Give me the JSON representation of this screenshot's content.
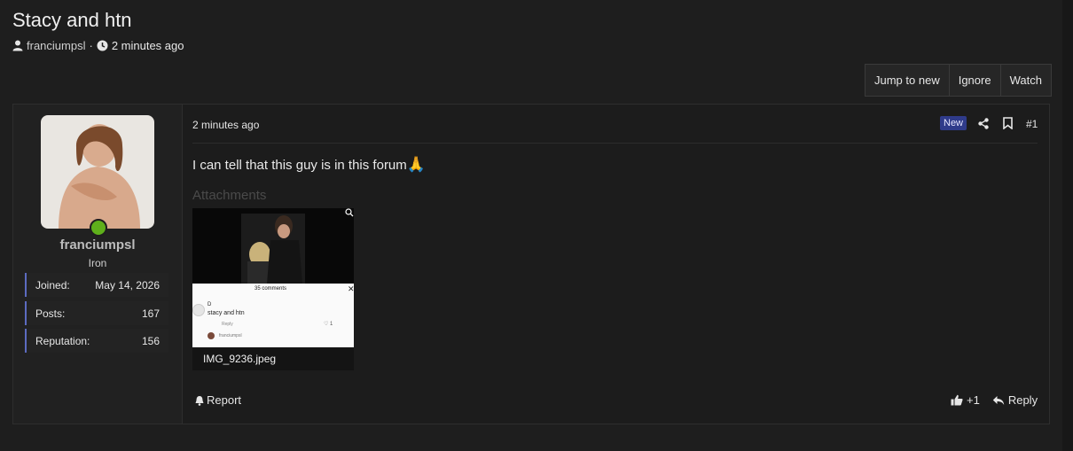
{
  "thread": {
    "title": "Stacy and htn",
    "author": "franciumpsl",
    "time_ago": "2 minutes ago"
  },
  "actions": {
    "jump_new": "Jump to new",
    "ignore": "Ignore",
    "watch": "Watch"
  },
  "user": {
    "name": "franciumpsl",
    "title": "Iron",
    "stats": [
      {
        "label": "Joined:",
        "value": "May 14, 2026"
      },
      {
        "label": "Posts:",
        "value": "167"
      },
      {
        "label": "Reputation:",
        "value": "156"
      }
    ],
    "online_color": "#5fb01b"
  },
  "post": {
    "date": "2 minutes ago",
    "badge": "New",
    "number": "#1",
    "text": "I can tell that this guy is in this forum",
    "emoji": "🙏",
    "attachments_label": "Attachments",
    "attachment": {
      "filename": "IMG_9236.jpeg",
      "comments_text": "35 comments",
      "comment_user": "D",
      "comment_text": "stacy and htn",
      "reply_label": "Reply",
      "like_count": "1",
      "reply_user": "franciumpsl"
    },
    "report_label": "Report",
    "reaction": "+1",
    "reply_label": "Reply"
  },
  "icons": [
    "user-icon",
    "clock-icon",
    "share-icon",
    "bookmark-icon",
    "zoom-icon",
    "bell-icon",
    "thumbs-up-icon",
    "reply-icon"
  ],
  "colors": {
    "accent": "#5c6bc0",
    "badge": "#2f3b8a",
    "background": "#1e1e1e"
  }
}
